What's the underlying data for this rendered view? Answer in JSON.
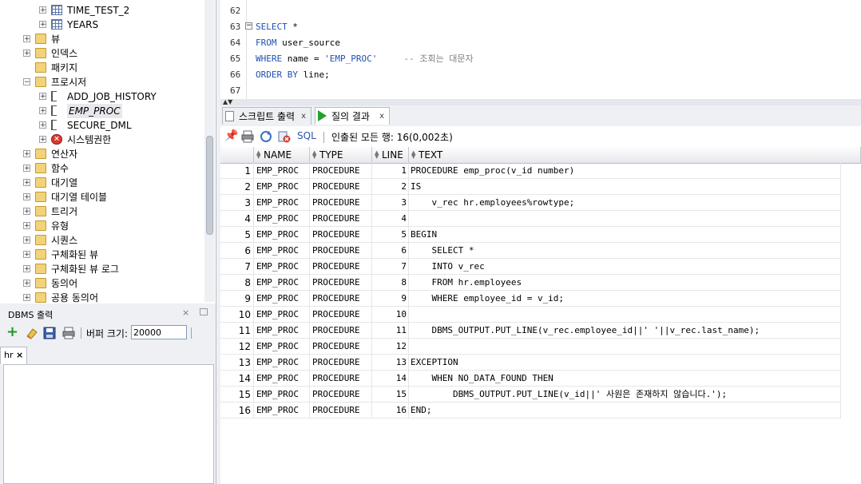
{
  "tree": {
    "items": [
      {
        "label": "TIME_TEST_2",
        "icon": "table-icon"
      },
      {
        "label": "YEARS",
        "icon": "table-icon"
      },
      {
        "label": "뷰",
        "icon": "folder-icon"
      },
      {
        "label": "인덱스",
        "icon": "folder-icon"
      },
      {
        "label": "패키지",
        "icon": "folder-icon"
      },
      {
        "label": "프로시저",
        "icon": "folder-icon"
      },
      {
        "label": "ADD_JOB_HISTORY",
        "icon": "procedure-icon"
      },
      {
        "label": "EMP_PROC",
        "icon": "procedure-icon"
      },
      {
        "label": "SECURE_DML",
        "icon": "procedure-icon"
      },
      {
        "label": "시스템권한",
        "icon": "error-icon"
      },
      {
        "label": "연산자",
        "icon": "folder-icon"
      },
      {
        "label": "함수",
        "icon": "folder-icon"
      },
      {
        "label": "대기열",
        "icon": "folder-icon"
      },
      {
        "label": "대기열 테이블",
        "icon": "folder-icon"
      },
      {
        "label": "트리거",
        "icon": "folder-icon"
      },
      {
        "label": "유형",
        "icon": "folder-icon"
      },
      {
        "label": "시퀀스",
        "icon": "folder-icon"
      },
      {
        "label": "구체화된 뷰",
        "icon": "folder-icon"
      },
      {
        "label": "구체화된 뷰 로그",
        "icon": "folder-icon"
      },
      {
        "label": "동의어",
        "icon": "folder-icon"
      },
      {
        "label": "공용 동의어",
        "icon": "folder-icon"
      }
    ]
  },
  "dbms": {
    "title": "DBMS 출력",
    "close": "×",
    "buffer_label": "버퍼 크기:",
    "buffer_value": "20000",
    "connection_tab": "hr",
    "connection_close": "×"
  },
  "editor": {
    "line_numbers": [
      "62",
      "63",
      "64",
      "65",
      "66",
      "67"
    ],
    "lines": [
      {
        "kw": "",
        "rest": ""
      },
      {
        "kw": "SELECT",
        "rest": " *"
      },
      {
        "kw": "FROM",
        "rest": " user_source"
      },
      {
        "kw": "WHERE",
        "rest": " name = ",
        "str": "'EMP_PROC'",
        "cmt": "     -- 조회는 대문자"
      },
      {
        "kw": "ORDER BY",
        "rest": " line;"
      },
      {
        "kw": "",
        "rest": ""
      }
    ]
  },
  "tabs": {
    "script_output": "스크립트 출력",
    "query_result": "질의 결과",
    "close": "x"
  },
  "result_toolbar": {
    "sql_label": "SQL",
    "fetch_info": "인출된 모든 행: 16(0,002초)"
  },
  "grid": {
    "columns": [
      "NAME",
      "TYPE",
      "LINE",
      "TEXT"
    ],
    "rows": [
      {
        "n": "1",
        "name": "EMP_PROC",
        "type": "PROCEDURE",
        "line": "1",
        "text": "PROCEDURE emp_proc(v_id number)"
      },
      {
        "n": "2",
        "name": "EMP_PROC",
        "type": "PROCEDURE",
        "line": "2",
        "text": "IS"
      },
      {
        "n": "3",
        "name": "EMP_PROC",
        "type": "PROCEDURE",
        "line": "3",
        "text": "    v_rec hr.employees%rowtype;"
      },
      {
        "n": "4",
        "name": "EMP_PROC",
        "type": "PROCEDURE",
        "line": "4",
        "text": ""
      },
      {
        "n": "5",
        "name": "EMP_PROC",
        "type": "PROCEDURE",
        "line": "5",
        "text": "BEGIN"
      },
      {
        "n": "6",
        "name": "EMP_PROC",
        "type": "PROCEDURE",
        "line": "6",
        "text": "    SELECT *"
      },
      {
        "n": "7",
        "name": "EMP_PROC",
        "type": "PROCEDURE",
        "line": "7",
        "text": "    INTO v_rec"
      },
      {
        "n": "8",
        "name": "EMP_PROC",
        "type": "PROCEDURE",
        "line": "8",
        "text": "    FROM hr.employees"
      },
      {
        "n": "9",
        "name": "EMP_PROC",
        "type": "PROCEDURE",
        "line": "9",
        "text": "    WHERE employee_id = v_id;"
      },
      {
        "n": "10",
        "name": "EMP_PROC",
        "type": "PROCEDURE",
        "line": "10",
        "text": ""
      },
      {
        "n": "11",
        "name": "EMP_PROC",
        "type": "PROCEDURE",
        "line": "11",
        "text": "    DBMS_OUTPUT.PUT_LINE(v_rec.employee_id||' '||v_rec.last_name);"
      },
      {
        "n": "12",
        "name": "EMP_PROC",
        "type": "PROCEDURE",
        "line": "12",
        "text": ""
      },
      {
        "n": "13",
        "name": "EMP_PROC",
        "type": "PROCEDURE",
        "line": "13",
        "text": "EXCEPTION"
      },
      {
        "n": "14",
        "name": "EMP_PROC",
        "type": "PROCEDURE",
        "line": "14",
        "text": "    WHEN NO_DATA_FOUND THEN"
      },
      {
        "n": "15",
        "name": "EMP_PROC",
        "type": "PROCEDURE",
        "line": "15",
        "text": "        DBMS_OUTPUT.PUT_LINE(v_id||' 사원은 존재하지 않습니다.');"
      },
      {
        "n": "16",
        "name": "EMP_PROC",
        "type": "PROCEDURE",
        "line": "16",
        "text": "END;"
      }
    ]
  }
}
